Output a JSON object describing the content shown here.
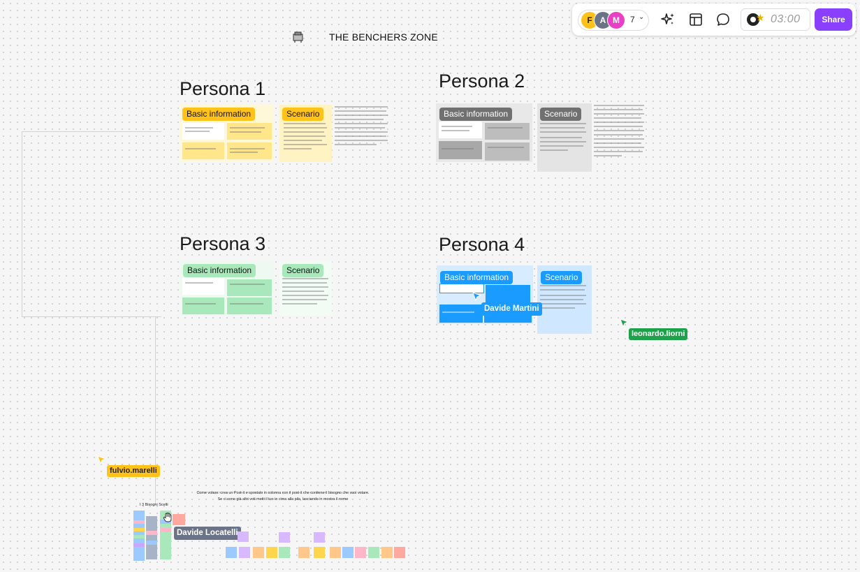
{
  "toolbar": {
    "avatars": [
      "F",
      "A",
      "M"
    ],
    "collaborator_count": "7",
    "timer": "03:00",
    "share_label": "Share",
    "icons": [
      "ai-sparkle-icon",
      "layout-icon",
      "comment-icon",
      "timer-icon"
    ]
  },
  "board": {
    "title": "THE BENCHERS ZONE"
  },
  "personas": [
    {
      "title": "Persona 1",
      "basic_label": "Basic information",
      "scenario_label": "Scenario",
      "color": "#ffd54d"
    },
    {
      "title": "Persona 2",
      "basic_label": "Basic information",
      "scenario_label": "Scenario",
      "color": "#707070"
    },
    {
      "title": "Persona 3",
      "basic_label": "Basic information",
      "scenario_label": "Scenario",
      "color": "#a8e8bb"
    },
    {
      "title": "Persona 4",
      "basic_label": "Basic information",
      "scenario_label": "Scenario",
      "color": "#1a9bff"
    }
  ],
  "cursors": [
    {
      "name": "Davide Martini",
      "color": "#1a9bff"
    },
    {
      "name": "leonardo.liorni",
      "color": "#1ea14a"
    },
    {
      "name": "fulvio.marelli",
      "color": "#ffc21a"
    },
    {
      "name": "Davide Locatelli",
      "color": "#6b7487"
    }
  ],
  "voting": {
    "instructions": "Come votare: crea un Post-it e spostalo in colonna con il post-it che contiene il bisogno che vuoi votare. Se ci sono già altri voti metti il tuo in cima alla pila, lasciando in mostra il nome",
    "title": "I 3 Bisogni Scelti"
  }
}
